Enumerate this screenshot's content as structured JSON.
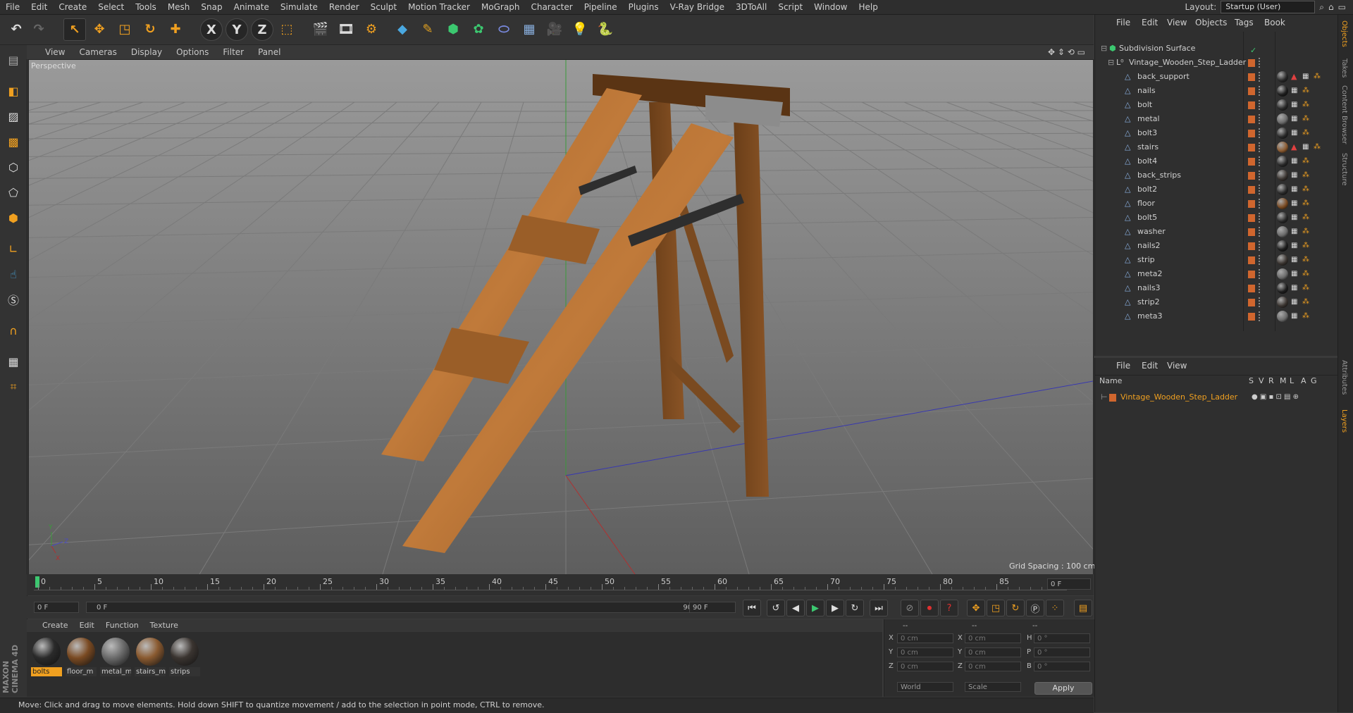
{
  "menubar": {
    "items": [
      "File",
      "Edit",
      "Create",
      "Select",
      "Tools",
      "Mesh",
      "Snap",
      "Animate",
      "Simulate",
      "Render",
      "Sculpt",
      "Motion Tracker",
      "MoGraph",
      "Character",
      "Pipeline",
      "Plugins",
      "V-Ray Bridge",
      "3DToAll",
      "Script",
      "Window",
      "Help"
    ],
    "layout_label": "Layout:",
    "layout_value": "Startup (User)"
  },
  "toolbar": {
    "axis_x": "X",
    "axis_y": "Y",
    "axis_z": "Z",
    "accent": "#f0a020"
  },
  "viewport": {
    "menu": [
      "View",
      "Cameras",
      "Display",
      "Options",
      "Filter",
      "Panel"
    ],
    "camera_label": "Perspective",
    "grid_spacing": "Grid Spacing : 100 cm"
  },
  "timeline": {
    "ticks": [
      "0",
      "5",
      "10",
      "15",
      "20",
      "25",
      "30",
      "35",
      "40",
      "45",
      "50",
      "55",
      "60",
      "65",
      "70",
      "75",
      "80",
      "85",
      "90"
    ],
    "current_frame": "0 F",
    "start_field": "0 F",
    "range_start": "0 F",
    "range_end": "90 F",
    "end_field": "90 F"
  },
  "materials": {
    "menu": [
      "Create",
      "Edit",
      "Function",
      "Texture"
    ],
    "items": [
      {
        "label": "bolts",
        "color": "#2a2a2a",
        "selected": true
      },
      {
        "label": "floor_m",
        "color": "#7a4a22",
        "selected": false
      },
      {
        "label": "metal_m",
        "color": "#6b6b6b",
        "selected": false
      },
      {
        "label": "stairs_m",
        "color": "#8a5a30",
        "selected": false
      },
      {
        "label": "strips",
        "color": "#3a3430",
        "selected": false
      }
    ]
  },
  "coords": {
    "header": [
      "--",
      "--",
      "--"
    ],
    "rows": [
      {
        "a": "X",
        "av": "0 cm",
        "b": "X",
        "bv": "0 cm",
        "c": "H",
        "cv": "0 °"
      },
      {
        "a": "Y",
        "av": "0 cm",
        "b": "Y",
        "bv": "0 cm",
        "c": "P",
        "cv": "0 °"
      },
      {
        "a": "Z",
        "av": "0 cm",
        "b": "Z",
        "bv": "0 cm",
        "c": "B",
        "cv": "0 °"
      }
    ],
    "world": "World",
    "scale": "Scale",
    "apply": "Apply"
  },
  "status_text": "Move: Click and drag to move elements. Hold down SHIFT to quantize movement / add to the selection in point mode, CTRL to remove.",
  "brand": "MAXON CINEMA 4D",
  "objects": {
    "menu": [
      "File",
      "Edit",
      "View",
      "Objects",
      "Tags",
      "Book"
    ],
    "root": "Subdivision Surface",
    "group": "Vintage_Wooden_Step_Ladder",
    "children": [
      "back_support",
      "nails",
      "bolt",
      "metal",
      "bolt3",
      "stairs",
      "bolt4",
      "back_strips",
      "bolt2",
      "floor",
      "bolt5",
      "washer",
      "nails2",
      "strip",
      "meta2",
      "nails3",
      "strip2",
      "meta3"
    ]
  },
  "layers": {
    "menu": [
      "File",
      "Edit",
      "View"
    ],
    "columns": [
      "Name",
      "S",
      "V",
      "R",
      "M",
      "L",
      "A",
      "G"
    ],
    "row": "Vintage_Wooden_Step_Ladder"
  },
  "side_tabs": [
    "Objects",
    "Takes",
    "Content Browser",
    "Structure",
    "Attributes",
    "Layers"
  ]
}
